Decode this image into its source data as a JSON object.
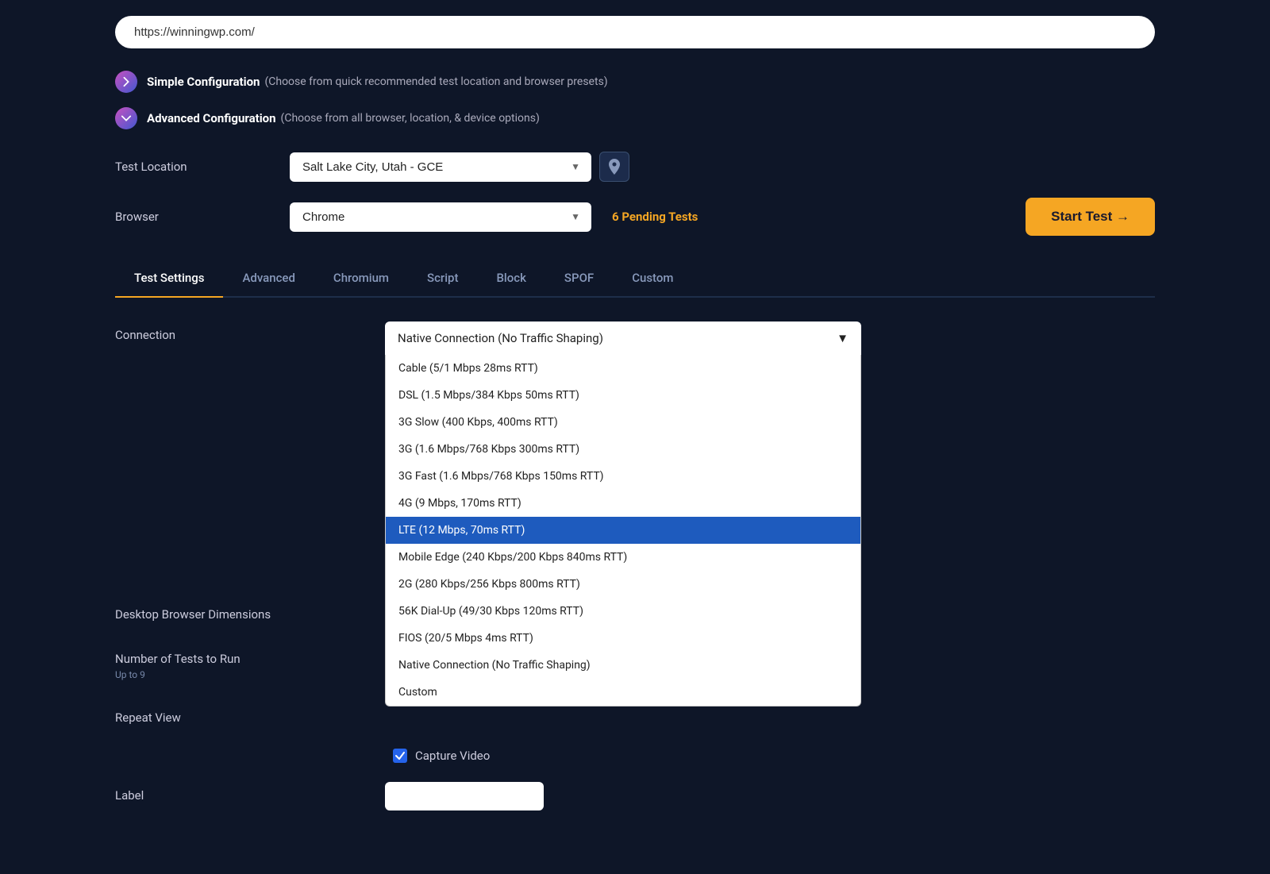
{
  "url": {
    "value": "https://winningwp.com/",
    "placeholder": "Enter URL"
  },
  "config": {
    "simple": {
      "label": "Simple Configuration",
      "description": "(Choose from quick recommended test location and browser presets)",
      "icon": "chevron-right"
    },
    "advanced": {
      "label": "Advanced Configuration",
      "description": "(Choose from all browser, location, & device options)",
      "icon": "chevron-down"
    }
  },
  "form": {
    "location_label": "Test Location",
    "location_value": "Salt Lake City, Utah - GCE",
    "browser_label": "Browser",
    "browser_value": "Chrome",
    "pending_tests": "6 Pending Tests",
    "start_test": "Start Test →"
  },
  "tabs": [
    {
      "id": "test-settings",
      "label": "Test Settings",
      "active": true
    },
    {
      "id": "advanced",
      "label": "Advanced",
      "active": false
    },
    {
      "id": "chromium",
      "label": "Chromium",
      "active": false
    },
    {
      "id": "script",
      "label": "Script",
      "active": false
    },
    {
      "id": "block",
      "label": "Block",
      "active": false
    },
    {
      "id": "spof",
      "label": "SPOF",
      "active": false
    },
    {
      "id": "custom",
      "label": "Custom",
      "active": false
    }
  ],
  "fields": {
    "connection_label": "Connection",
    "connection_value": "Native Connection (No Traffic Shaping)",
    "desktop_browser_label": "Desktop Browser Dimensions",
    "number_tests_label": "Number of Tests to Run",
    "number_tests_sublabel": "Up to 9",
    "repeat_view_label": "Repeat View",
    "capture_video_label": "Capture Video",
    "label_label": "Label"
  },
  "connection_options": [
    {
      "value": "cable",
      "label": "Cable (5/1 Mbps 28ms RTT)",
      "selected": false
    },
    {
      "value": "dsl",
      "label": "DSL (1.5 Mbps/384 Kbps 50ms RTT)",
      "selected": false
    },
    {
      "value": "3g-slow",
      "label": "3G Slow (400 Kbps, 400ms RTT)",
      "selected": false
    },
    {
      "value": "3g",
      "label": "3G (1.6 Mbps/768 Kbps 300ms RTT)",
      "selected": false
    },
    {
      "value": "3g-fast",
      "label": "3G Fast (1.6 Mbps/768 Kbps 150ms RTT)",
      "selected": false
    },
    {
      "value": "4g",
      "label": "4G (9 Mbps, 170ms RTT)",
      "selected": false
    },
    {
      "value": "lte",
      "label": "LTE (12 Mbps, 70ms RTT)",
      "selected": true
    },
    {
      "value": "mobile-edge",
      "label": "Mobile Edge (240 Kbps/200 Kbps 840ms RTT)",
      "selected": false
    },
    {
      "value": "2g",
      "label": "2G (280 Kbps/256 Kbps 800ms RTT)",
      "selected": false
    },
    {
      "value": "56k",
      "label": "56K Dial-Up (49/30 Kbps 120ms RTT)",
      "selected": false
    },
    {
      "value": "fios",
      "label": "FIOS (20/5 Mbps 4ms RTT)",
      "selected": false
    },
    {
      "value": "native",
      "label": "Native Connection (No Traffic Shaping)",
      "selected": false
    },
    {
      "value": "custom",
      "label": "Custom",
      "selected": false
    }
  ],
  "colors": {
    "background": "#0e1628",
    "accent_orange": "#f5a623",
    "accent_blue": "#2563eb",
    "selected_blue": "#1e5bbe"
  }
}
